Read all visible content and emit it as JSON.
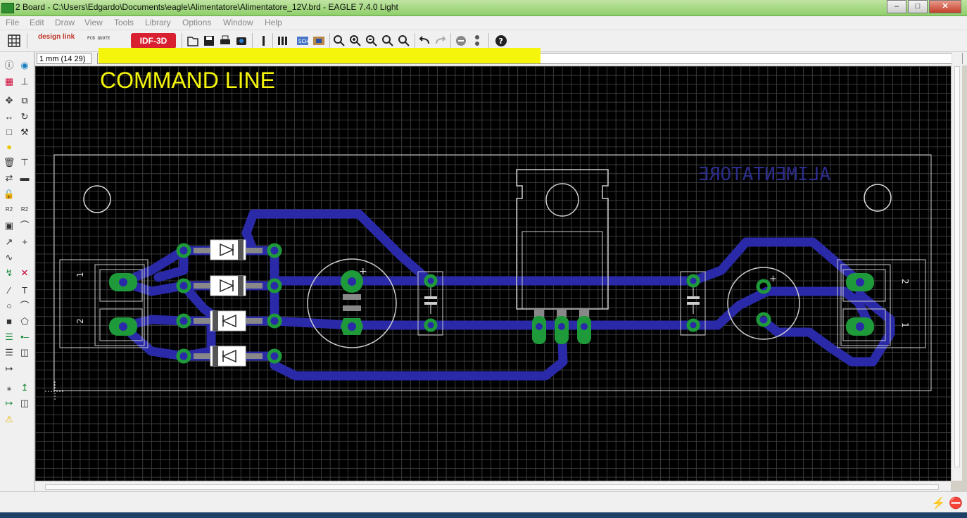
{
  "window": {
    "title": "2 Board - C:\\Users\\Edgardo\\Documents\\eagle\\Alimentatore\\Alimentatore_12V.brd - EAGLE 7.4.0 Light",
    "buttons": [
      "minimize",
      "maximize",
      "close"
    ]
  },
  "menu": [
    "File",
    "Edit",
    "Draw",
    "View",
    "Tools",
    "Library",
    "Options",
    "Window",
    "Help"
  ],
  "toolbar": {
    "logo_design_link": "design link",
    "logo_pcb_quote": "PCB QUOTE",
    "idf_button": "IDF-3D",
    "icons": [
      "grid-icon",
      "open-icon",
      "save-icon",
      "print-icon",
      "cam-icon",
      "script-icon",
      "ulp-icon",
      "sch-icon",
      "board-icon",
      "zoom-fit-icon",
      "zoom-in-icon",
      "zoom-out-icon",
      "zoom-redraw-icon",
      "zoom-select-icon",
      "undo-icon",
      "redo-icon",
      "stop-icon",
      "go-icon",
      "help-icon"
    ]
  },
  "command": {
    "coord": "1 mm (14 29)",
    "placeholder": "",
    "annotation": "COMMAND LINE"
  },
  "board": {
    "silk_text": "ALIMENTATORE",
    "connector_left_pins": [
      "1",
      "2"
    ],
    "connector_right_pins": [
      "2",
      "1"
    ],
    "cap_polarity": [
      "+",
      "+"
    ],
    "colors": {
      "background": "#000000",
      "trace": "#2a2aa8",
      "pad": "#1e9a3a",
      "silk": "#c8c8c8",
      "text": "#2d2d8a",
      "annotation": "#f5f50c"
    }
  },
  "left_toolbar": [
    "info-icon",
    "show-icon",
    "display-icon",
    "mark-icon",
    "move-icon",
    "copy-icon",
    "mirror-icon",
    "rotate-icon",
    "group-icon",
    "change-icon",
    "paste-icon",
    "delete-icon",
    "add-icon",
    "replace-icon",
    "lock-icon",
    "name-icon",
    "value-icon",
    "smash-icon",
    "miter-icon",
    "split-icon",
    "optimize-icon",
    "route-icon",
    "ripup-icon",
    "wire-icon",
    "text-icon",
    "circle-icon",
    "arc-icon",
    "rect-icon",
    "polygon-icon",
    "via-icon",
    "signal-icon",
    "hole-icon",
    "attribute-icon",
    "dimension-icon",
    "ratsnest-icon",
    "auto-icon",
    "drc-icon",
    "errors-icon",
    "warning-icon"
  ],
  "status": {
    "text": ""
  }
}
